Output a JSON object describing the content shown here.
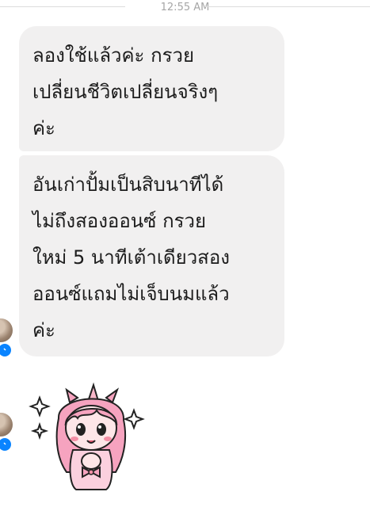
{
  "header": {
    "timestamp": "12:55 AM"
  },
  "messages": [
    {
      "lines": [
        "ลองใช้แล้วค่ะ กรวย",
        "เปลี่ยนชีวิตเปลี่ยนจริงๆ",
        "ค่ะ"
      ]
    },
    {
      "lines": [
        "อันเก่าปั้มเป็นสิบนาทีได้",
        "ไม่ถึงสองออนซ์ กรวย",
        "ใหม่ 5 นาทีเต้าเดียวสอง",
        "ออนซ์แถมไม่เจ็บนมแล้ว",
        "ค่ะ"
      ]
    }
  ],
  "icons": {
    "avatar": "avatar-icon",
    "badge": "messenger-icon",
    "sticker": "cute-girl-sticker"
  },
  "colors": {
    "bubble_bg": "#f1f0f0",
    "messenger_blue": "#0a84ff",
    "timestamp_text": "#a6a6a6"
  }
}
